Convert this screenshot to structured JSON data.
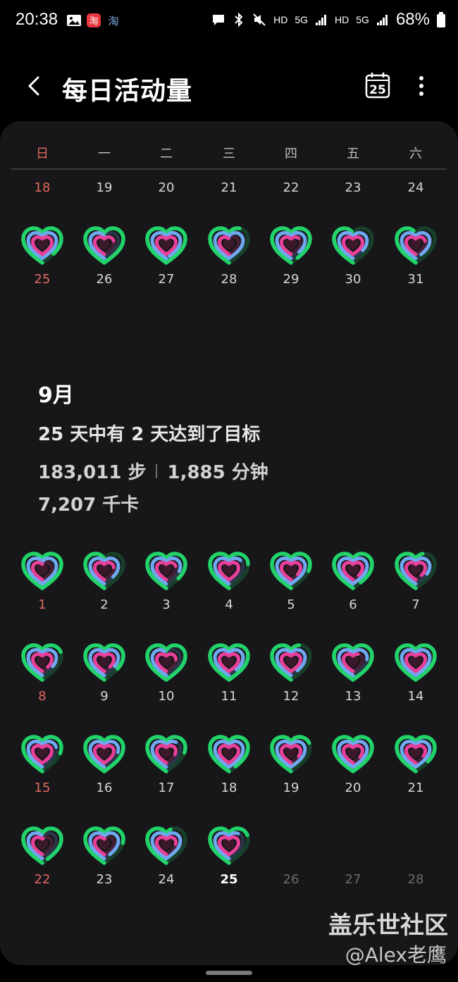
{
  "status": {
    "time": "20:38",
    "net1": "HD",
    "net2": "5G",
    "net3": "HD",
    "net4": "5G",
    "battery": "68%"
  },
  "header": {
    "title": "每日活动量",
    "calendar_day": "25"
  },
  "weekdays": [
    "日",
    "一",
    "二",
    "三",
    "四",
    "五",
    "六"
  ],
  "august_rows": [
    [
      "18",
      "19",
      "20",
      "21",
      "22",
      "23",
      "24"
    ],
    [
      "25",
      "26",
      "27",
      "28",
      "29",
      "30",
      "31"
    ]
  ],
  "september": {
    "month": "9月",
    "summary": "25 天中有 2 天达到了目标",
    "steps": "183,011 步",
    "minutes": "1,885 分钟",
    "kcal": "7,207 千卡",
    "weeks": [
      [
        "1",
        "2",
        "3",
        "4",
        "5",
        "6",
        "7"
      ],
      [
        "8",
        "9",
        "10",
        "11",
        "12",
        "13",
        "14"
      ],
      [
        "15",
        "16",
        "17",
        "18",
        "19",
        "20",
        "21"
      ],
      [
        "22",
        "23",
        "24",
        "25",
        "26",
        "27",
        "28"
      ]
    ],
    "today": "25"
  },
  "watermark": {
    "line1": "盖乐世社区",
    "line2": "@Alex老鹰"
  },
  "colors": {
    "outer": "#22d36a",
    "middle": "#6fa8f0",
    "inner": "#e8409a",
    "sunday": "#e2695f"
  }
}
